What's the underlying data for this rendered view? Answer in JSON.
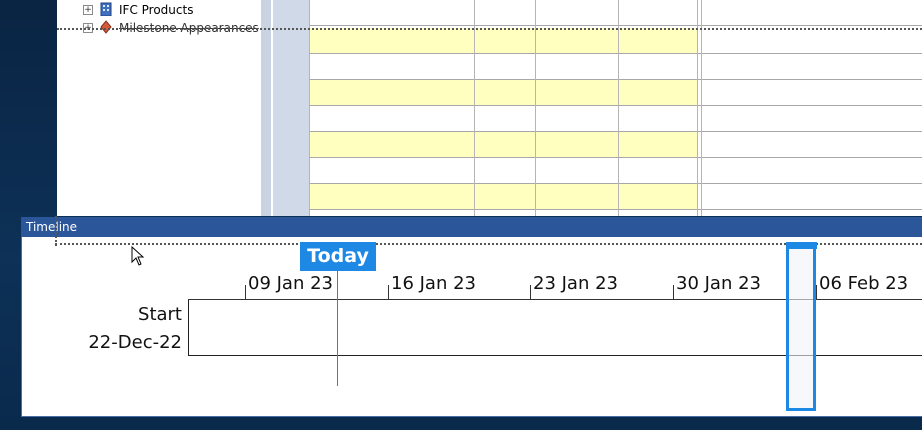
{
  "tree": {
    "items": [
      {
        "label": "IFC Products",
        "icon": "building-icon"
      },
      {
        "label": "Milestone Appearances",
        "icon": "milestone-diamond-icon"
      }
    ]
  },
  "timeline": {
    "panel_title": "Timeline",
    "today_label": "Today",
    "start_label": "Start",
    "start_date": "22-Dec-22",
    "ticks": [
      "09 Jan 23",
      "16 Jan 23",
      "23 Jan 23",
      "30 Jan 23",
      "06 Feb 23"
    ]
  },
  "colors": {
    "accent": "#1e88e5",
    "header": "#2b579a",
    "row_highlight": "#ffffc0"
  }
}
